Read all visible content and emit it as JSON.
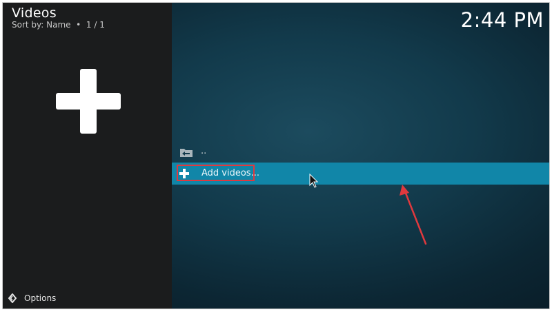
{
  "header": {
    "title": "Videos",
    "sort_label": "Sort by: Name",
    "bullet": "•",
    "page": "1 / 1"
  },
  "clock": {
    "time": "2:44 PM"
  },
  "list": {
    "parent_label": "..",
    "add_label": "Add videos..."
  },
  "footer": {
    "options_label": "Options"
  },
  "colors": {
    "highlight_row": "#1186a8",
    "annotation_red": "#e0393e",
    "left_pane": "#1b1c1d"
  },
  "icons": {
    "big": "plus-icon",
    "parent": "folder-back-icon",
    "add": "plus-icon",
    "options": "options-chevron-icon",
    "cursor": "mouse-pointer-icon",
    "annotation": "red-arrow-annotation"
  }
}
